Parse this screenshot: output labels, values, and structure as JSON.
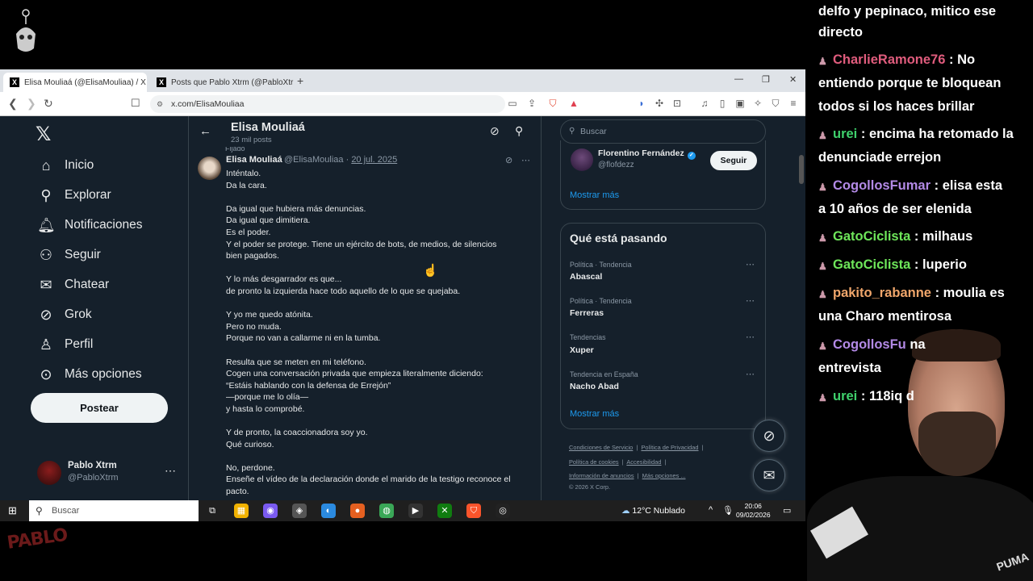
{
  "browser": {
    "tabs": [
      {
        "label": "Elisa Mouliaá (@ElisaMouliaa) / X",
        "active": true
      },
      {
        "label": "Posts que Pablo Xtrm (@PabloXtrm) / X",
        "active": false
      }
    ],
    "url": "x.com/ElisaMouliaa"
  },
  "sidebar": {
    "items": [
      {
        "label": "Inicio",
        "icon": "home-icon",
        "glyph": "⌂"
      },
      {
        "label": "Explorar",
        "icon": "search-icon",
        "glyph": "⚲"
      },
      {
        "label": "Notificaciones",
        "icon": "bell-icon",
        "glyph": "♫"
      },
      {
        "label": "Seguir",
        "icon": "follow-icon",
        "glyph": "⚇"
      },
      {
        "label": "Chatear",
        "icon": "mail-icon",
        "glyph": "✉"
      },
      {
        "label": "Grok",
        "icon": "grok-icon",
        "glyph": "⊘"
      },
      {
        "label": "Perfil",
        "icon": "person-icon",
        "glyph": "⚲"
      },
      {
        "label": "Más opciones",
        "icon": "more-circle-icon",
        "glyph": "⋯"
      }
    ],
    "post_label": "Postear",
    "account": {
      "name": "Pablo Xtrm",
      "handle": "@PabloXtrm"
    }
  },
  "main": {
    "title": "Elisa Mouliaá",
    "subtitle": "23 mil posts",
    "pinned_label": "Fijado",
    "tweet": {
      "name": "Elisa Mouliaá",
      "handle": "@ElisaMouliaa",
      "date": "20 jul. 2025",
      "lines": [
        "Inténtalo.",
        "Da la cara.",
        "",
        "Da igual que hubiera más denuncias.",
        "Da igual que dimitiera.",
        "Es el poder.",
        "Y el poder se protege. Tiene un ejército de bots, de medios, de silencios",
        "bien pagados.",
        "",
        "Y lo más desgarrador es que...",
        "de pronto la izquierda hace todo aquello de lo que se quejaba.",
        "",
        "Y yo me quedo atónita.",
        "Pero no muda.",
        "Porque no van a callarme ni en la tumba.",
        "",
        "Resulta que se meten en mi teléfono.",
        "Cogen una conversación privada que empieza literalmente diciendo:",
        "“Estáis hablando con la defensa de Errejón”",
        "—porque me lo olía—",
        "y hasta lo comprobé.",
        "",
        "Y de pronto, la coaccionadora soy yo.",
        "Qué curioso.",
        "",
        "No, perdone.",
        "Enseñe el vídeo de la declaración donde el marido de la testigo reconoce el",
        "pacto."
      ]
    }
  },
  "right": {
    "search_placeholder": "Buscar",
    "who_to_follow": {
      "name": "Florentino Fernández",
      "handle": "@flofdezz",
      "follow_label": "Seguir"
    },
    "show_more": "Mostrar más",
    "trends_title": "Qué está pasando",
    "trends": [
      {
        "category": "Política · Tendencia",
        "name": "Abascal"
      },
      {
        "category": "Política · Tendencia",
        "name": "Ferreras"
      },
      {
        "category": "Tendencias",
        "name": "Xuper"
      },
      {
        "category": "Tendencia en España",
        "name": "Nacho Abad"
      }
    ],
    "trends_show_more": "Mostrar más",
    "footer": {
      "line1": [
        "Condiciones de Servicio",
        "Política de Privacidad"
      ],
      "line2": [
        "Política de cookies",
        "Accesibilidad"
      ],
      "line3": [
        "Información de anuncios",
        "Más opciones ..."
      ],
      "copyright": "© 2026 X Corp."
    }
  },
  "taskbar": {
    "search_placeholder": "Buscar",
    "weather": "12°C  Nublado",
    "time": "20:06",
    "date": "09/02/2026"
  },
  "chat": [
    {
      "user": "",
      "message": "delfo y pepinaco, mitico ese",
      "color": "#ffffff"
    },
    {
      "user": "",
      "message": "directo",
      "color": "#ffffff"
    },
    {
      "user": "CharlieRamone76",
      "message": ": No",
      "color": "#e05c7d"
    },
    {
      "user": "",
      "message": "entiendo porque te bloquean",
      "color": "#ffffff"
    },
    {
      "user": "",
      "message": "todos si los haces brillar",
      "color": "#ffffff"
    },
    {
      "user": "urei",
      "message": ": encima ha retomado la",
      "color": "#3fd16c"
    },
    {
      "user": "",
      "message": "denunciade errejon",
      "color": "#ffffff"
    },
    {
      "user": "CogollosFumar",
      "message": ": elisa esta",
      "color": "#b38ae6"
    },
    {
      "user": "",
      "message": "a 10 años de ser elenida",
      "color": "#ffffff"
    },
    {
      "user": "GatoCiclista",
      "message": ": milhaus",
      "color": "#6ee65a"
    },
    {
      "user": "GatoCiclista",
      "message": ": luperio",
      "color": "#6ee65a"
    },
    {
      "user": "pakito_rabanne",
      "message": ": moulia es",
      "color": "#f0a66b"
    },
    {
      "user": "",
      "message": "una Charo mentirosa",
      "color": "#ffffff"
    },
    {
      "user": "CogollosFu",
      "message": "na",
      "color": "#b38ae6"
    },
    {
      "user": "",
      "message": "entrevista",
      "color": "#ffffff"
    },
    {
      "user": "urei",
      "message": ": 118iq d",
      "color": "#3fd16c"
    }
  ],
  "webcam": {
    "shirt_brand": "PUMA"
  },
  "overlay": {
    "corner_logo": "PABLO"
  },
  "colors": {
    "x_bg": "#15202b",
    "x_blue": "#1d9bf0",
    "border": "#38444d"
  }
}
